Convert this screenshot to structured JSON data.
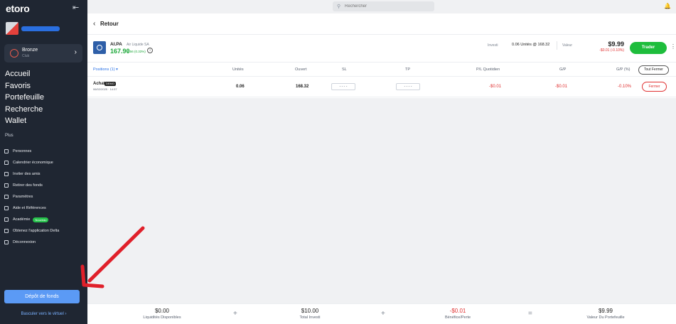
{
  "brand": {
    "logo": "etoro"
  },
  "tier": {
    "name": "Bronze",
    "sub": "Club"
  },
  "nav": {
    "main": [
      "Accueil",
      "Favoris",
      "Portefeuille",
      "Recherche",
      "Wallet"
    ],
    "more_label": "Plus",
    "sub": [
      {
        "label": "Personnes",
        "icon": "people-icon"
      },
      {
        "label": "Calendrier économique",
        "icon": "calendar-icon"
      },
      {
        "label": "Inviter des amis",
        "icon": "invite-icon"
      },
      {
        "label": "Retirer des fonds",
        "icon": "withdraw-icon"
      },
      {
        "label": "Paramètres",
        "icon": "gear-icon"
      },
      {
        "label": "Aide et Références",
        "icon": "help-icon"
      },
      {
        "label": "Académie",
        "icon": "academy-icon",
        "badge": "Nouveau"
      },
      {
        "label": "Obtenez l'application Delta",
        "icon": "delta-icon"
      },
      {
        "label": "Déconnexion",
        "icon": "logout-icon"
      }
    ],
    "deposit": "Dépôt de fonds",
    "switch_virtual": "Basculer vers le virtuel ›"
  },
  "search": {
    "placeholder": "Rechercher"
  },
  "page": {
    "back": "Retour"
  },
  "instrument": {
    "ticker": "AI.PA",
    "name": "Air Liquide SA",
    "price": "167.90",
    "change": "0.56 (0.33%)",
    "invest_label": "Investi",
    "units_info": "0.06 Unités @ 168.32",
    "value_label": "Valeur",
    "value": "$9.99",
    "value_pl": "-$0.01 (-0.10%)",
    "trade": "Trader"
  },
  "table": {
    "headers": [
      "Positions (1) ▾",
      "Unités",
      "Ouvert",
      "SL",
      "TP",
      "P/L Quotidien",
      "G/P",
      "G/P (%)"
    ],
    "close_all": "Tout Fermer",
    "row": {
      "side": "Achat",
      "badge": "DEMO",
      "date": "06/02/2025 · 14:37",
      "units": "0.06",
      "open": "168.32",
      "sl": "- - - -",
      "tp": "- - - -",
      "daily_pl": "-$0.01",
      "pl": "-$0.01",
      "pl_pct": "-0.10%",
      "close": "Fermer"
    }
  },
  "footer": {
    "items": [
      {
        "value": "$0.00",
        "label": "Liquidités Disponibles"
      },
      {
        "value": "$10.00",
        "label": "Total Investi"
      },
      {
        "value": "-$0.01",
        "label": "Bénéfice/Perte"
      },
      {
        "value": "$9.99",
        "label": "Valeur Du Portefeuille"
      }
    ],
    "ops": [
      "+",
      "+",
      "="
    ]
  },
  "colors": {
    "accent": "#1ebd3c",
    "negative": "#e03131",
    "sidebar": "#1f2632",
    "link": "#2b73e6"
  }
}
